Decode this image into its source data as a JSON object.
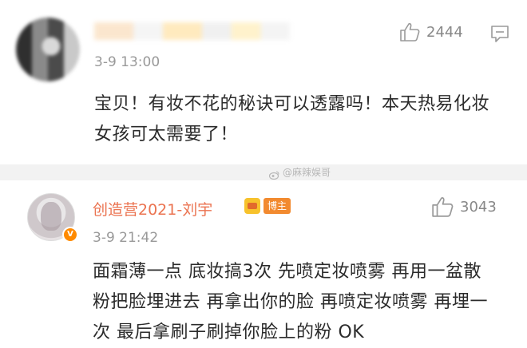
{
  "comments": [
    {
      "username": "",
      "timestamp": "3-9 13:00",
      "likes": "2444",
      "text": "宝贝！有妆不花的秘诀可以透露吗！本天热易化妆女孩可太需要了！"
    },
    {
      "username": "创造营2021-刘宇",
      "badge": "博主",
      "timestamp": "3-9 21:42",
      "likes": "3043",
      "text": "面霜薄一点 底妆搞3次 先喷定妆喷雾 再用一盆散粉把脸埋进去 再拿出你的脸 再喷定妆喷雾 再埋一次 最后拿刷子刷掉你脸上的粉 OK"
    }
  ],
  "watermark": "@麻辣娱哥",
  "colors": {
    "username": "#eb7350",
    "meta": "#999999",
    "host_badge": "#f28a2f",
    "divider": "#f2f2f2"
  },
  "icons": {
    "like": "thumbs-up-icon",
    "reply": "comment-icon",
    "verified": "v-badge-icon",
    "crown": "crown-badge-icon",
    "weibo": "weibo-logo-icon"
  }
}
